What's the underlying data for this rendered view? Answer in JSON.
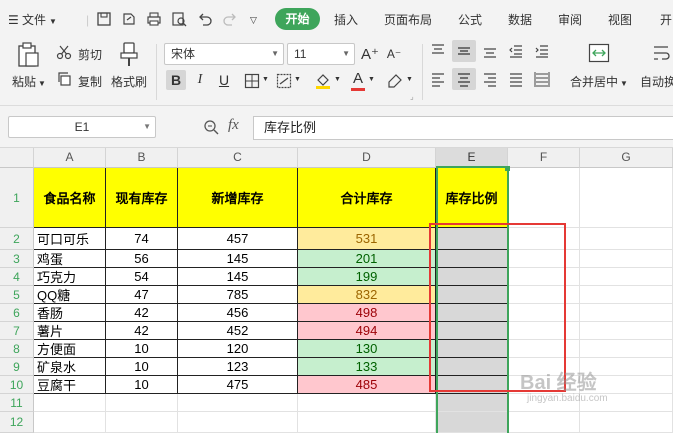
{
  "menubar": {
    "file_label": "文件",
    "tabs": [
      "开始",
      "插入",
      "页面布局",
      "公式",
      "数据",
      "审阅",
      "视图",
      "开"
    ]
  },
  "ribbon": {
    "paste_label": "粘贴",
    "cut_label": "剪切",
    "copy_label": "复制",
    "format_painter_label": "格式刷",
    "font_name": "宋体",
    "font_size": "11",
    "merge_center_label": "合并居中",
    "wrap_label": "自动换"
  },
  "formula_bar": {
    "name_box": "E1",
    "fx_label": "fx",
    "formula": "库存比例"
  },
  "sheet": {
    "columns": [
      "A",
      "B",
      "C",
      "D",
      "E",
      "F",
      "G"
    ],
    "rows": [
      "1",
      "2",
      "3",
      "4",
      "5",
      "6",
      "7",
      "8",
      "9",
      "10",
      "11",
      "12"
    ],
    "headers": [
      "食品名称",
      "现有库存",
      "新增库存",
      "合计库存",
      "库存比例"
    ],
    "data": [
      [
        "可口可乐",
        "74",
        "457",
        "531"
      ],
      [
        "鸡蛋",
        "56",
        "145",
        "201"
      ],
      [
        "巧克力",
        "54",
        "145",
        "199"
      ],
      [
        "QQ糖",
        "47",
        "785",
        "832"
      ],
      [
        "香肠",
        "42",
        "456",
        "498"
      ],
      [
        "薯片",
        "42",
        "452",
        "494"
      ],
      [
        "方便面",
        "10",
        "120",
        "130"
      ],
      [
        "矿泉水",
        "10",
        "123",
        "133"
      ],
      [
        "豆腐干",
        "10",
        "475",
        "485"
      ]
    ],
    "total_cell_styles": [
      "yellow",
      "green",
      "green",
      "yellow",
      "red",
      "red",
      "green",
      "green",
      "red"
    ],
    "colors": {
      "accent": "#3ea55b",
      "header_fill": "#ffff00",
      "yellow_fill": "#ffeb9c",
      "green_fill": "#c6efce",
      "red_fill": "#ffc7ce",
      "highlight_box": "#e53935"
    }
  },
  "watermark": {
    "text": "Bai 经验",
    "sub": "jingyan.baidu.com"
  }
}
